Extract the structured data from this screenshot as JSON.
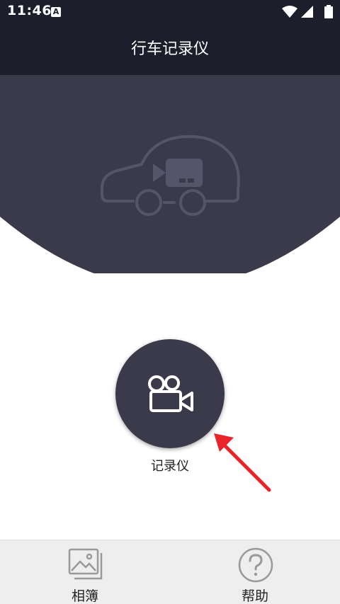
{
  "status_bar": {
    "time": "11:46",
    "notification_badge": "A",
    "icons": [
      "wifi-icon",
      "cellular-signal-icon",
      "battery-icon"
    ]
  },
  "header": {
    "title": "行车记录仪"
  },
  "main": {
    "recorder": {
      "label": "记录仪",
      "icon": "video-camera-icon"
    },
    "illustration": "car-camera-icon"
  },
  "bottom_nav": {
    "items": [
      {
        "label": "相簿",
        "icon": "photo-album-icon"
      },
      {
        "label": "帮助",
        "icon": "help-icon"
      }
    ]
  },
  "colors": {
    "status_bar": "#1c1f2b",
    "hero": "#3b3a4a",
    "button": "#3b3a4a",
    "arrow": "#e8232a",
    "bottom_nav": "#eeeeee"
  }
}
